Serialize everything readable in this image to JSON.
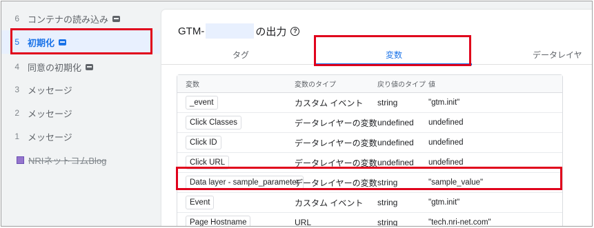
{
  "sidebar": {
    "items": [
      {
        "num": "6",
        "label": "コンテナの読み込み",
        "badge": true
      },
      {
        "num": "5",
        "label": "初期化",
        "badge": true,
        "active": true
      },
      {
        "num": "4",
        "label": "同意の初期化",
        "badge": true
      },
      {
        "num": "3",
        "label": "メッセージ"
      },
      {
        "num": "2",
        "label": "メッセージ"
      },
      {
        "num": "1",
        "label": "メッセージ"
      }
    ],
    "blog_label": "NRIネットコムBlog"
  },
  "main": {
    "title_prefix": "GTM-",
    "title_suffix": "の出力",
    "help_glyph": "?",
    "tabs": [
      {
        "label": "タグ"
      },
      {
        "label": "変数",
        "active": true
      },
      {
        "label": "データレイヤ"
      }
    ]
  },
  "table": {
    "headers": [
      "変数",
      "変数のタイプ",
      "戻り値のタイプ",
      "値"
    ],
    "rows": [
      {
        "name": "_event",
        "type": "カスタム イベント",
        "return": "string",
        "value": "\"gtm.init\""
      },
      {
        "name": "Click Classes",
        "type": "データレイヤーの変数",
        "return": "undefined",
        "value": "undefined"
      },
      {
        "name": "Click ID",
        "type": "データレイヤーの変数",
        "return": "undefined",
        "value": "undefined"
      },
      {
        "name": "Click URL",
        "type": "データレイヤーの変数",
        "return": "undefined",
        "value": "undefined"
      },
      {
        "name": "Data layer - sample_parameter",
        "type": "データレイヤーの変数",
        "return": "string",
        "value": "\"sample_value\""
      },
      {
        "name": "Event",
        "type": "カスタム イベント",
        "return": "string",
        "value": "\"gtm.init\""
      },
      {
        "name": "Page Hostname",
        "type": "URL",
        "return": "string",
        "value": "\"tech.nri-net.com\""
      }
    ]
  },
  "colors": {
    "accent": "#1a73e8",
    "highlight": "#e0001b",
    "blog_square": "#9575cd"
  }
}
